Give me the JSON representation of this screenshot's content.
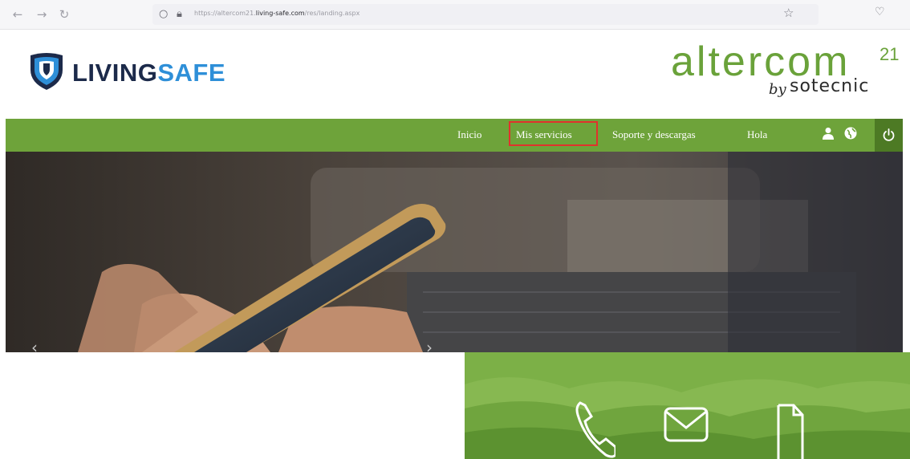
{
  "browser": {
    "url_prefix": "https://altercom21.",
    "url_domain": "living-safe.com",
    "url_path": "/res/landing.aspx",
    "icons": [
      "back-icon",
      "forward-icon",
      "reload-icon",
      "shield-icon",
      "lock-icon",
      "star-icon",
      "pocket-icon"
    ]
  },
  "header": {
    "brand_part1": "LIVING",
    "brand_part2": "SAFE",
    "partner_word": "altercom",
    "partner_sup": "21",
    "partner_by": "by",
    "partner_company": "sotecnic",
    "colors": {
      "brand_dark": "#1c2a4a",
      "brand_blue": "#2e8fd8",
      "partner_green": "#6aa23a"
    }
  },
  "nav": {
    "items": [
      "Inicio",
      "Mis servicios",
      "Soporte y descargas",
      "Hola"
    ],
    "highlighted": "Mis servicios",
    "icons": [
      "user-icon",
      "globe-icon",
      "power-icon"
    ],
    "colors": {
      "bar": "#6ea33a",
      "highlight_border": "#e0322c",
      "power_bg": "#4d7a24"
    }
  },
  "hero": {
    "arrows": [
      "‹",
      "›"
    ]
  },
  "panel": {
    "icons": [
      "phone-icon",
      "mail-icon",
      "document-icon"
    ]
  }
}
